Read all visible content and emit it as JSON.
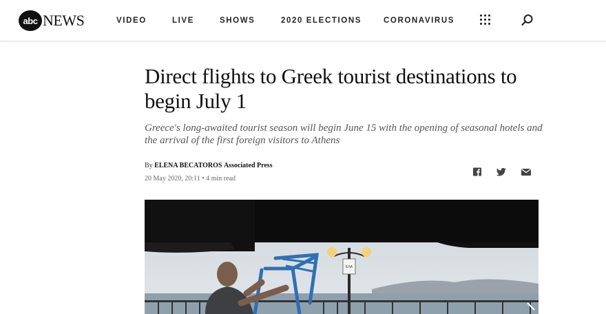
{
  "brand": {
    "logo_mark": "abc",
    "logo_word": "NEWS"
  },
  "nav": {
    "items": [
      {
        "label": "VIDEO"
      },
      {
        "label": "LIVE"
      },
      {
        "label": "SHOWS"
      },
      {
        "label": "2020 ELECTIONS"
      },
      {
        "label": "CORONAVIRUS"
      }
    ],
    "menu_icon": "grid-dots-icon",
    "search_icon": "search-icon"
  },
  "article": {
    "headline": "Direct flights to Greek tourist destinations to begin July 1",
    "subhead": "Greece's long-awaited tourist season will begin June 15 with the opening of seasonal hotels and the arrival of the first foreign visitors to Athens",
    "byline_prefix": "By",
    "author": "ELENA BECATOROS",
    "source": "Associated Press",
    "date": "20 May 2020, 20:11",
    "read_time": "• 4 min read"
  },
  "share": {
    "icons": [
      "facebook-icon",
      "twitter-icon",
      "email-icon"
    ]
  },
  "hero": {
    "sign_text": "ΕΛΑ"
  }
}
